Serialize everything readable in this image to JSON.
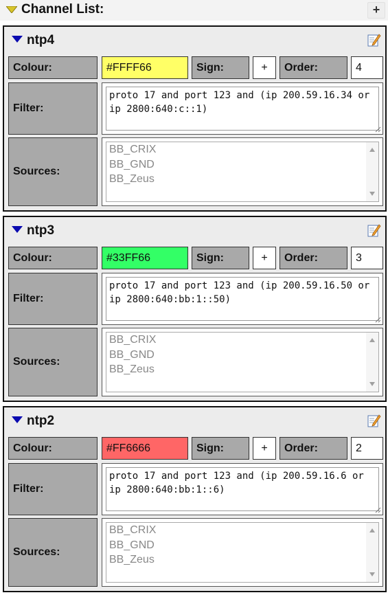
{
  "header": {
    "title": "Channel List:",
    "add_label": "+"
  },
  "labels": {
    "colour": "Colour:",
    "sign": "Sign:",
    "order": "Order:",
    "filter": "Filter:",
    "sources": "Sources:"
  },
  "channels": [
    {
      "name": "ntp4",
      "colour": "#FFFF66",
      "sign": "+",
      "order": "4",
      "filter": "proto 17 and port 123 and (ip 200.59.16.34 or ip 2800:640:c::1)",
      "sources": [
        "BB_CRIX",
        "BB_GND",
        "BB_Zeus"
      ]
    },
    {
      "name": "ntp3",
      "colour": "#33FF66",
      "sign": "+",
      "order": "3",
      "filter": "proto 17 and port 123 and (ip 200.59.16.50 or ip 2800:640:bb:1::50)",
      "sources": [
        "BB_CRIX",
        "BB_GND",
        "BB_Zeus"
      ]
    },
    {
      "name": "ntp2",
      "colour": "#FF6666",
      "sign": "+",
      "order": "2",
      "filter": "proto 17 and port 123 and (ip 200.59.16.6 or ip 2800:640:bb:1::6)",
      "sources": [
        "BB_CRIX",
        "BB_GND",
        "BB_Zeus"
      ]
    }
  ]
}
